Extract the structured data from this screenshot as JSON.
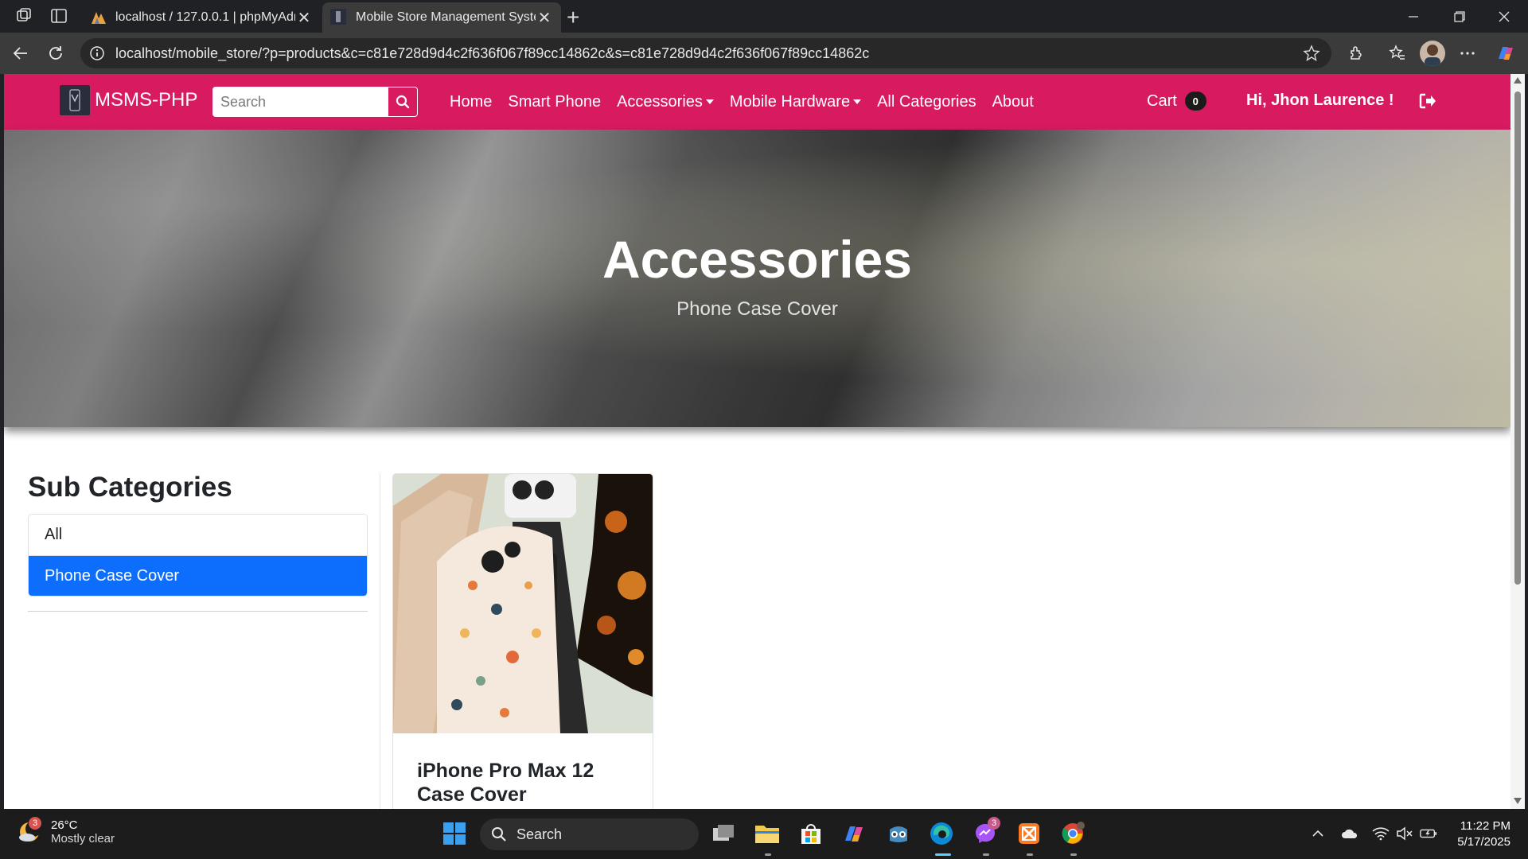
{
  "browser": {
    "tabs": [
      {
        "title": "localhost / 127.0.0.1 | phpMyAdm",
        "active": false
      },
      {
        "title": "Mobile Store Management Syster",
        "active": true
      }
    ],
    "url": "localhost/mobile_store/?p=products&c=c81e728d9d4c2f636f067f89cc14862c&s=c81e728d9d4c2f636f067f89cc14862c"
  },
  "navbar": {
    "brand": "MSMS-PHP",
    "search_placeholder": "Search",
    "links": {
      "home": "Home",
      "smart_phone": "Smart Phone",
      "accessories": "Accessories",
      "mobile_hardware": "Mobile Hardware",
      "all_categories": "All Categories",
      "about": "About"
    },
    "cart_label": "Cart",
    "cart_count": "0",
    "greeting": "Hi, Jhon Laurence !",
    "color": "#d81b60"
  },
  "hero": {
    "title": "Accessories",
    "subtitle": "Phone Case Cover"
  },
  "sidebar": {
    "heading": "Sub Categories",
    "items": [
      {
        "label": "All",
        "active": false
      },
      {
        "label": "Phone Case Cover",
        "active": true
      }
    ],
    "active_color": "#0d6efd"
  },
  "products": [
    {
      "name": "iPhone Pro Max 12 Case Cover",
      "image": "phone-case-product-image"
    }
  ],
  "taskbar": {
    "weather_temp": "26°C",
    "weather_desc": "Mostly clear",
    "weather_badge": "3",
    "search_label": "Search",
    "messenger_badge": "3",
    "time": "11:22 PM",
    "date": "5/17/2025"
  }
}
